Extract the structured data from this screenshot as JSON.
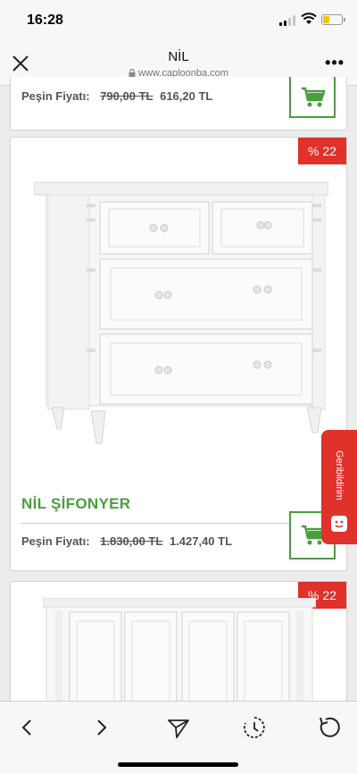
{
  "status_bar": {
    "time": "16:28"
  },
  "header": {
    "title": "NİL",
    "url": "www.caploonba.com"
  },
  "products": [
    {
      "price_label": "Peşin Fiyatı:",
      "old_price": "790,00 TL",
      "new_price": "616,20 TL"
    },
    {
      "discount": "% 22",
      "name": "NİL ŞİFONYER",
      "price_label": "Peşin Fiyatı:",
      "old_price": "1.830,00 TL",
      "new_price": "1.427,40 TL"
    },
    {
      "discount": "% 22"
    }
  ],
  "feedback_tab": {
    "label": "Geribildirim"
  },
  "colors": {
    "accent_green": "#4a9e3e",
    "badge_red": "#e0312a"
  },
  "toolbar": {
    "icons": [
      "back-icon",
      "forward-icon",
      "share-icon",
      "history-icon",
      "reload-icon"
    ]
  }
}
